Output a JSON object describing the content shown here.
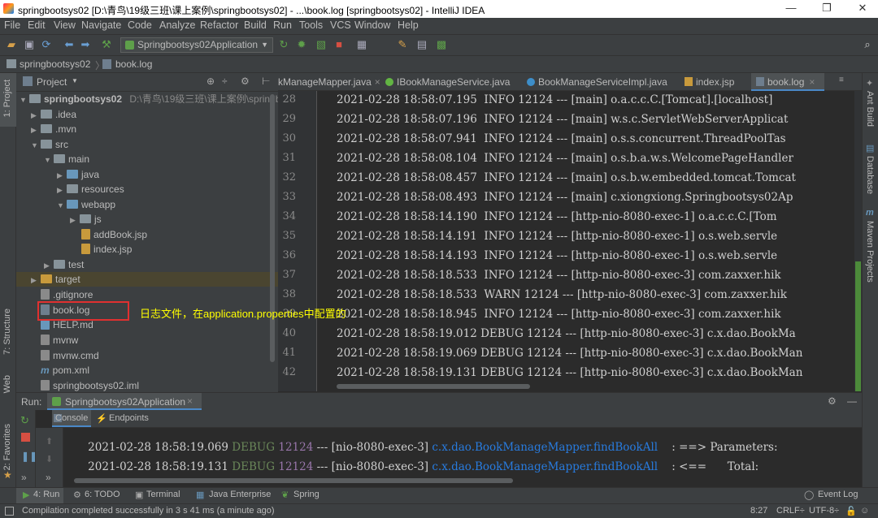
{
  "window": {
    "title": "springbootsys02 [D:\\青鸟\\19级三班\\课上案例\\springbootsys02] - ...\\book.log [springbootsys02] - IntelliJ IDEA",
    "min": "—",
    "max": "❐",
    "close": "✕"
  },
  "menu": [
    "File",
    "Edit",
    "View",
    "Navigate",
    "Code",
    "Analyze",
    "Refactor",
    "Build",
    "Run",
    "Tools",
    "VCS",
    "Window",
    "Help"
  ],
  "toolbar": {
    "run_config": "Springbootsys02Application"
  },
  "breadcrumb": {
    "project": "springbootsys02",
    "file": "book.log"
  },
  "project_panel": {
    "title": "Project",
    "tree": [
      {
        "label": "springbootsys02",
        "extra": "D:\\青鸟\\19级三班\\课上案例\\springboot"
      },
      {
        "label": ".idea"
      },
      {
        "label": ".mvn"
      },
      {
        "label": "src"
      },
      {
        "label": "main"
      },
      {
        "label": "java"
      },
      {
        "label": "resources"
      },
      {
        "label": "webapp"
      },
      {
        "label": "js"
      },
      {
        "label": "addBook.jsp"
      },
      {
        "label": "index.jsp"
      },
      {
        "label": "test"
      },
      {
        "label": "target"
      },
      {
        "label": ".gitignore"
      },
      {
        "label": "book.log"
      },
      {
        "label": "HELP.md"
      },
      {
        "label": "mvnw"
      },
      {
        "label": "mvnw.cmd"
      },
      {
        "label": "pom.xml"
      },
      {
        "label": "springbootsys02.iml"
      }
    ],
    "annotation": "日志文件，在application.properties中配置的"
  },
  "editor_tabs": [
    {
      "label": "kManageMapper.java"
    },
    {
      "label": "IBookManageService.java"
    },
    {
      "label": "BookManageServiceImpl.java"
    },
    {
      "label": "index.jsp"
    },
    {
      "label": "book.log",
      "active": true
    }
  ],
  "editor_lines": [
    {
      "n": "28",
      "text": "2021-02-28 18:58:07.195  INFO 12124 --- [main] o.a.c.c.C.[Tomcat].[localhost]"
    },
    {
      "n": "29",
      "text": "2021-02-28 18:58:07.196  INFO 12124 --- [main] w.s.c.ServletWebServerApplicat"
    },
    {
      "n": "30",
      "text": "2021-02-28 18:58:07.941  INFO 12124 --- [main] o.s.s.concurrent.ThreadPoolTas"
    },
    {
      "n": "31",
      "text": "2021-02-28 18:58:08.104  INFO 12124 --- [main] o.s.b.a.w.s.WelcomePageHandler"
    },
    {
      "n": "32",
      "text": "2021-02-28 18:58:08.457  INFO 12124 --- [main] o.s.b.w.embedded.tomcat.Tomcat"
    },
    {
      "n": "33",
      "text": "2021-02-28 18:58:08.493  INFO 12124 --- [main] c.xiongxiong.Springbootsys02Ap"
    },
    {
      "n": "34",
      "text": "2021-02-28 18:58:14.190  INFO 12124 --- [http-nio-8080-exec-1] o.a.c.c.C.[Tom"
    },
    {
      "n": "35",
      "text": "2021-02-28 18:58:14.191  INFO 12124 --- [http-nio-8080-exec-1] o.s.web.servle"
    },
    {
      "n": "36",
      "text": "2021-02-28 18:58:14.193  INFO 12124 --- [http-nio-8080-exec-1] o.s.web.servle"
    },
    {
      "n": "37",
      "text": "2021-02-28 18:58:18.533  INFO 12124 --- [http-nio-8080-exec-3] com.zaxxer.hik"
    },
    {
      "n": "38",
      "text": "2021-02-28 18:58:18.533  WARN 12124 --- [http-nio-8080-exec-3] com.zaxxer.hik"
    },
    {
      "n": "39",
      "text": "2021-02-28 18:58:18.945  INFO 12124 --- [http-nio-8080-exec-3] com.zaxxer.hik"
    },
    {
      "n": "40",
      "text": "2021-02-28 18:58:19.012 DEBUG 12124 --- [http-nio-8080-exec-3] c.x.dao.BookMa"
    },
    {
      "n": "41",
      "text": "2021-02-28 18:58:19.069 DEBUG 12124 --- [http-nio-8080-exec-3] c.x.dao.BookMan"
    },
    {
      "n": "42",
      "text": "2021-02-28 18:58:19.131 DEBUG 12124 --- [http-nio-8080-exec-3] c.x.dao.BookMan"
    }
  ],
  "run_panel": {
    "label": "Run:",
    "config": "Springbootsys02Application",
    "tabs": [
      "Console",
      "Endpoints"
    ],
    "lines": [
      {
        "ts": "2021-02-28 18:58:19.069",
        "level": "DEBUG",
        "pid": "12124",
        "sep": "---",
        "thread": "[nio-8080-exec-3]",
        "logger": "c.x.dao.BookManageMapper.findBookAll",
        "msg": ": ==> Parameters:"
      },
      {
        "ts": "2021-02-28 18:58:19.131",
        "level": "DEBUG",
        "pid": "12124",
        "sep": "---",
        "thread": "[nio-8080-exec-3]",
        "logger": "c.x.dao.BookManageMapper.findBookAll",
        "msg": ": <==      Total:"
      }
    ]
  },
  "left_stripe": [
    "1: Project",
    "7: Structure",
    "Web",
    "2: Favorites"
  ],
  "right_stripe": [
    "Ant Build",
    "Database",
    "Maven Projects"
  ],
  "tool_windows": [
    "4: Run",
    "6: TODO",
    "Terminal",
    "Java Enterprise",
    "Spring"
  ],
  "event_log": "Event Log",
  "status": {
    "message": "Compilation completed successfully in 3 s 41 ms (a minute ago)",
    "position": "8:27",
    "line_sep": "CRLF÷",
    "encoding": "UTF-8÷"
  },
  "colors": {
    "debug": "#6a8759",
    "pid": "#9876aa",
    "logger": "#287bde",
    "annotation": "#ffff00",
    "highlight_box": "#e03030"
  }
}
